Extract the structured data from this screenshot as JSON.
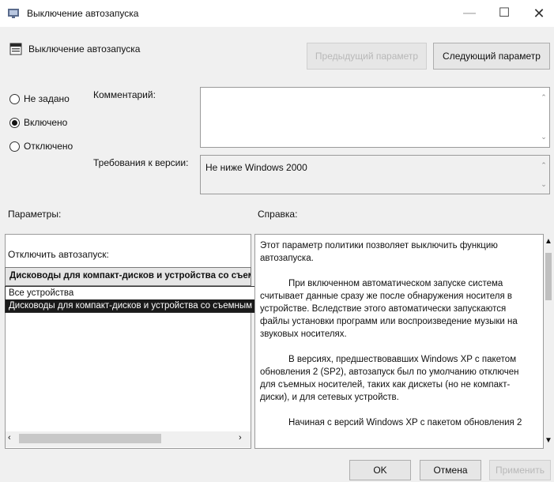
{
  "window": {
    "title": "Выключение автозапуска",
    "controls": {
      "minimize": "—",
      "maximize": "☐",
      "close": "✕"
    }
  },
  "header": {
    "policy_title": "Выключение автозапуска",
    "prev_button": "Предыдущий параметр",
    "next_button": "Следующий параметр"
  },
  "state": {
    "options": [
      "Не задано",
      "Включено",
      "Отключено"
    ],
    "selected": "Включено"
  },
  "comment": {
    "label": "Комментарий:",
    "value": ""
  },
  "version": {
    "label": "Требования к версии:",
    "value": "Не ниже Windows 2000"
  },
  "params": {
    "label": "Параметры:",
    "autorun_label": "Отключить автозапуск:",
    "autorun_value": "Дисководы для компакт-дисков и устройства со съемным носителем",
    "dropdown_options": [
      "Все устройства",
      "Дисководы для компакт-дисков и устройства со съемным носителем"
    ]
  },
  "help": {
    "label": "Справка:",
    "paragraphs": [
      "Этот параметр политики позволяет выключить функцию автозапуска.",
      "При включенном автоматическом запуске система считывает данные сразу же после обнаружения носителя в устройстве. Вследствие этого автоматически запускаются файлы установки программ или воспроизведение музыки на звуковых носителях.",
      "В версиях, предшествовавших Windows XP с пакетом обновления 2 (SP2), автозапуск был по умолчанию отключен для съемных носителей, таких как дискеты (но не компакт-диски), и для сетевых устройств.",
      "Начиная с версий Windows XP с пакетом обновления 2"
    ]
  },
  "footer": {
    "ok": "OK",
    "cancel": "Отмена",
    "apply": "Применить"
  },
  "colors": {
    "dialog_bg": "#f0f0f0",
    "selection": "#1a1a1a",
    "disabled_text": "#b8b8b8"
  }
}
